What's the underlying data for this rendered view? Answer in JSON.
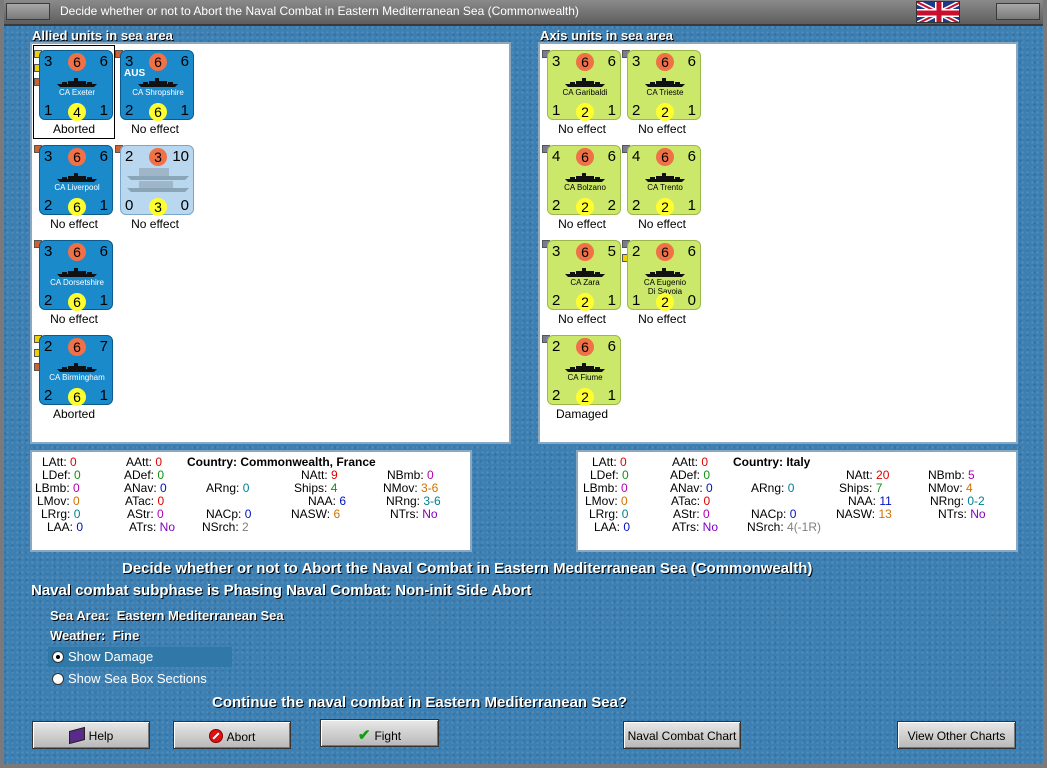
{
  "window": {
    "title": "Decide whether or not to Abort the Naval Combat in Eastern Mediterranean Sea (Commonwealth)"
  },
  "allied": {
    "heading": "Allied units in sea area",
    "units": [
      {
        "name": "CA Exeter",
        "tl": "3",
        "att": "6",
        "tr": "6",
        "bl": "1",
        "def": "4",
        "br": "1",
        "status": "Aborted",
        "nation": "",
        "style": "allied",
        "selected": true,
        "dots": [
          "#f0d000",
          "#f0d000",
          "#d06030"
        ]
      },
      {
        "name": "CA Shropshire",
        "tl": "3",
        "att": "6",
        "tr": "6",
        "bl": "2",
        "def": "6",
        "br": "1",
        "status": "No effect",
        "nation": "AUS",
        "style": "allied",
        "selected": false,
        "dots": [
          "#d06030"
        ]
      },
      {
        "name": "CA Liverpool",
        "tl": "3",
        "att": "6",
        "tr": "6",
        "bl": "2",
        "def": "6",
        "br": "1",
        "status": "No effect",
        "nation": "",
        "style": "allied",
        "selected": false,
        "dots": [
          "#d06030"
        ]
      },
      {
        "name": "",
        "tl": "2",
        "att": "3",
        "tr": "10",
        "bl": "0",
        "def": "3",
        "br": "0",
        "status": "No effect",
        "nation": "",
        "style": "light",
        "selected": false,
        "dots": [
          "#d06030"
        ]
      },
      {
        "name": "CA Dorsetshire",
        "tl": "3",
        "att": "6",
        "tr": "6",
        "bl": "2",
        "def": "6",
        "br": "1",
        "status": "No effect",
        "nation": "",
        "style": "allied",
        "selected": false,
        "dots": [
          "#d06030"
        ]
      },
      {
        "name": "CA Birmingham",
        "tl": "2",
        "att": "6",
        "tr": "7",
        "bl": "2",
        "def": "6",
        "br": "1",
        "status": "Aborted",
        "nation": "",
        "style": "allied",
        "selected": false,
        "dots": [
          "#f0d000",
          "#f0d000",
          "#d06030"
        ]
      }
    ]
  },
  "axis": {
    "heading": "Axis units in sea area",
    "units": [
      {
        "name": "CA Garibaldi",
        "tl": "3",
        "att": "6",
        "tr": "6",
        "bl": "1",
        "def": "2",
        "br": "1",
        "status": "No effect",
        "style": "axis",
        "dots": [
          "#7a7a90"
        ]
      },
      {
        "name": "CA Trieste",
        "tl": "3",
        "att": "6",
        "tr": "6",
        "bl": "2",
        "def": "2",
        "br": "1",
        "status": "No effect",
        "style": "axis",
        "dots": [
          "#7a7a90"
        ]
      },
      {
        "name": "CA Bolzano",
        "tl": "4",
        "att": "6",
        "tr": "6",
        "bl": "2",
        "def": "2",
        "br": "2",
        "status": "No effect",
        "style": "axis",
        "dots": [
          "#7a7a90"
        ]
      },
      {
        "name": "CA Trento",
        "tl": "4",
        "att": "6",
        "tr": "6",
        "bl": "2",
        "def": "2",
        "br": "1",
        "status": "No effect",
        "style": "axis",
        "dots": [
          "#7a7a90"
        ]
      },
      {
        "name": "CA Zara",
        "tl": "3",
        "att": "6",
        "tr": "5",
        "bl": "2",
        "def": "2",
        "br": "1",
        "status": "No effect",
        "style": "axis",
        "dots": [
          "#7a7a90"
        ]
      },
      {
        "name": "CA Eugenio\nDi Savoia",
        "tl": "2",
        "att": "6",
        "tr": "6",
        "bl": "1",
        "def": "2",
        "br": "0",
        "status": "No effect",
        "style": "axis",
        "dots": [
          "#7a7a90",
          "#f0d000"
        ]
      },
      {
        "name": "CA Fiume",
        "tl": "2",
        "att": "6",
        "tr": "6",
        "bl": "2",
        "def": "2",
        "br": "1",
        "status": "Damaged",
        "style": "axis",
        "dots": [
          "#7a7a90"
        ]
      }
    ]
  },
  "allied_stats": {
    "country_label": "Country:",
    "country": "Commonwealth, France",
    "LAtt": "0",
    "LDef": "0",
    "LBmb": "0",
    "LMov": "0",
    "LRrg": "0",
    "LAA": "0",
    "AAtt": "0",
    "ADef": "0",
    "ANav": "0",
    "ATac": "0",
    "AStr": "0",
    "ATrs": "No",
    "ARng": "0",
    "NACp": "0",
    "NSrch": "2",
    "NAtt": "9",
    "Ships": "4",
    "NAA": "6",
    "NASW": "6",
    "NBmb": "0",
    "NMov": "3-6",
    "NRng": "3-6",
    "NTrs": "No"
  },
  "axis_stats": {
    "country_label": "Country:",
    "country": "Italy",
    "LAtt": "0",
    "LDef": "0",
    "LBmb": "0",
    "LMov": "0",
    "LRrg": "0",
    "LAA": "0",
    "AAtt": "0",
    "ADef": "0",
    "ANav": "0",
    "ATac": "0",
    "AStr": "0",
    "ATrs": "No",
    "ARng": "0",
    "NACp": "0",
    "NSrch": "4(-1R)",
    "NAtt": "20",
    "Ships": "7",
    "NAA": "11",
    "NASW": "13",
    "NBmb": "5",
    "NMov": "4",
    "NRng": "0-2",
    "NTrs": "No"
  },
  "messages": {
    "decide": "Decide whether or not to Abort the Naval Combat in Eastern Mediterranean Sea (Commonwealth)",
    "subphase": "Naval combat subphase is Phasing Naval Combat: Non-init Side Abort",
    "sea_area_label": "Sea Area:",
    "sea_area": "Eastern Mediterranean Sea",
    "weather_label": "Weather:",
    "weather": "Fine",
    "question": "Continue the naval combat in Eastern Mediterranean Sea?"
  },
  "options": {
    "show_damage": "Show Damage",
    "show_damage_checked": true,
    "show_sections": "Show Sea Box Sections",
    "show_sections_checked": false
  },
  "buttons": {
    "help": "Help",
    "abort": "Abort",
    "fight": "Fight",
    "naval_chart": "Naval Combat Chart",
    "other_charts": "View Other Charts"
  },
  "colors": {
    "allied_counter": "#1a8acb",
    "axis_counter": "#cbe86a",
    "background": "#3c7fb2"
  }
}
